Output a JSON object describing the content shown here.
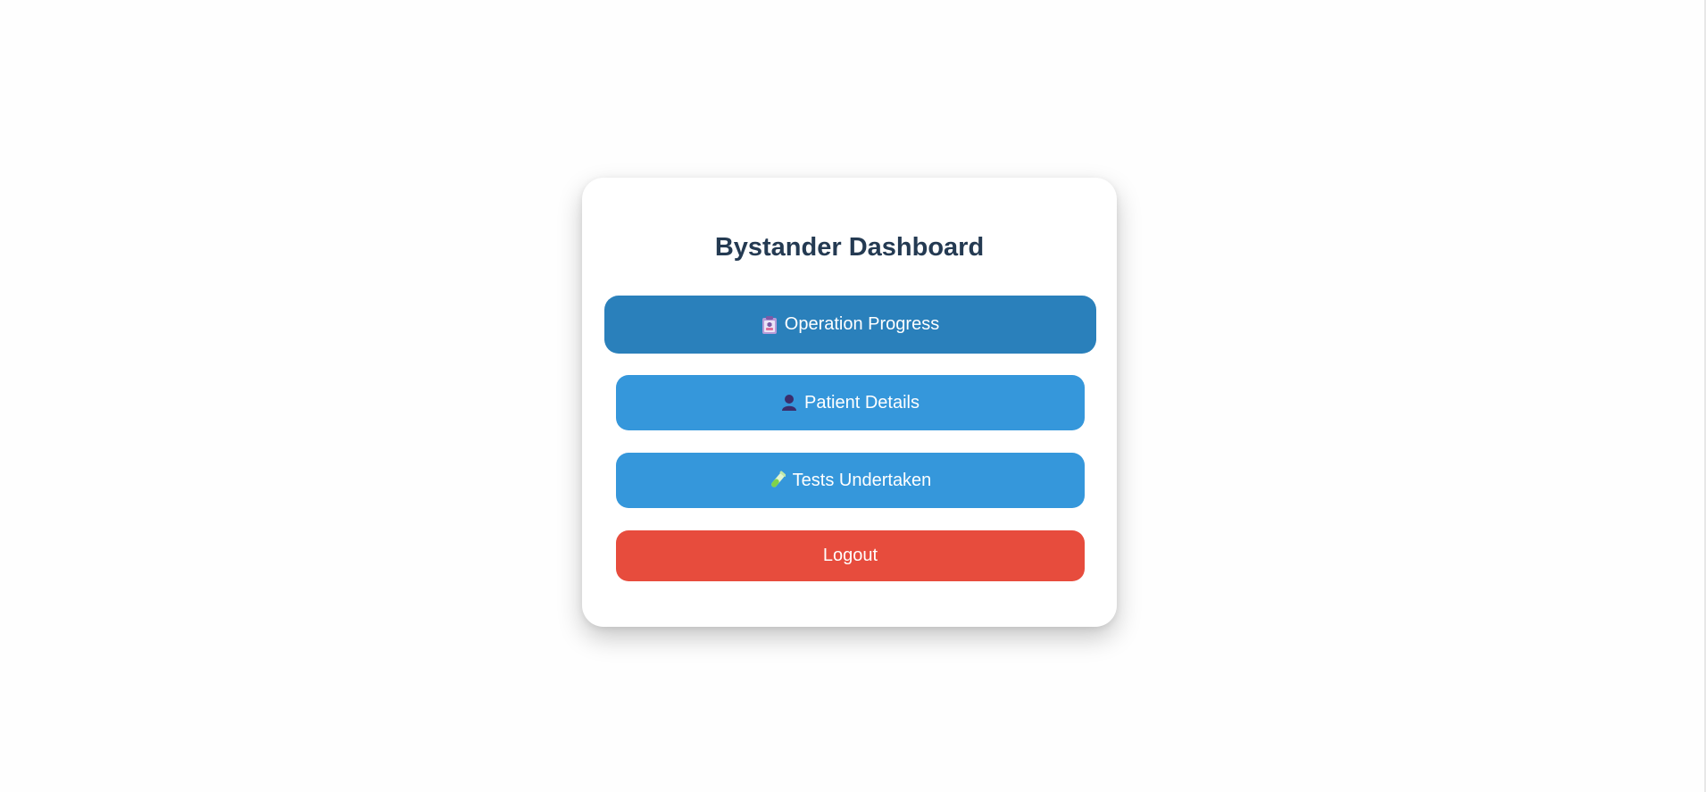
{
  "dashboard": {
    "title": "Bystander Dashboard",
    "buttons": {
      "operation_progress": {
        "label": "Operation Progress",
        "icon": "clipboard-icon"
      },
      "patient_details": {
        "label": "Patient Details",
        "icon": "user-icon"
      },
      "tests_undertaken": {
        "label": "Tests Undertaken",
        "icon": "test-tube-icon"
      },
      "logout": {
        "label": "Logout"
      }
    }
  },
  "colors": {
    "title": "#243a52",
    "button_active": "#2a80bb",
    "button": "#3597db",
    "logout": "#e74c3d"
  }
}
